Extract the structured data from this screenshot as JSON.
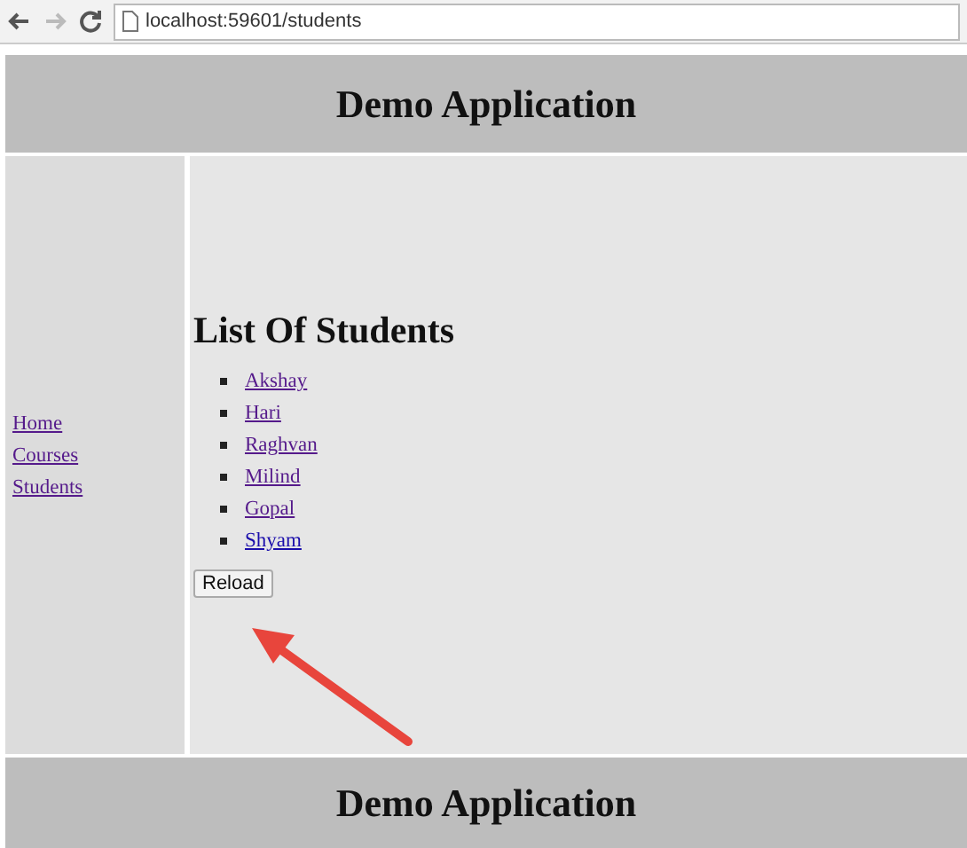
{
  "browser": {
    "address": "localhost:59601/students",
    "back_disabled": false,
    "forward_disabled": true
  },
  "header": {
    "title": "Demo Application"
  },
  "sidebar": {
    "items": [
      {
        "label": "Home",
        "visited": true
      },
      {
        "label": "Courses",
        "visited": true
      },
      {
        "label": "Students",
        "visited": true
      }
    ]
  },
  "main": {
    "heading": "List Of Students",
    "students": [
      {
        "label": "Akshay",
        "visited": true
      },
      {
        "label": "Hari",
        "visited": true
      },
      {
        "label": "Raghvan",
        "visited": true
      },
      {
        "label": "Milind",
        "visited": true
      },
      {
        "label": "Gopal",
        "visited": true
      },
      {
        "label": "Shyam",
        "visited": false
      }
    ],
    "button": "Reload"
  },
  "footer": {
    "title": "Demo Application"
  }
}
